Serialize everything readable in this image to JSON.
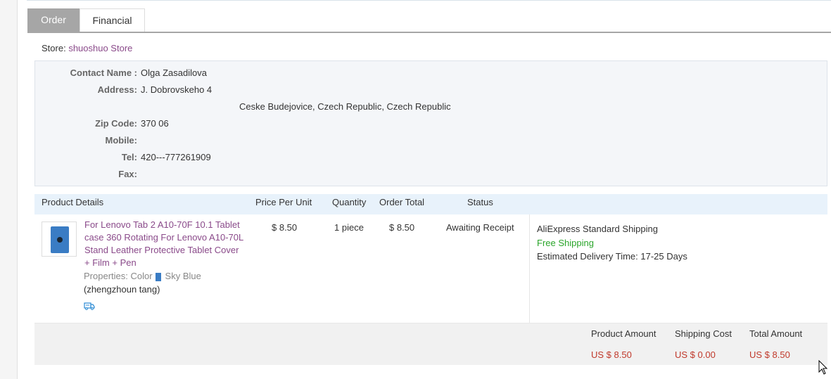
{
  "tabs": [
    "Order",
    "Financial"
  ],
  "store": {
    "label": "Store:",
    "name": "shuoshuo Store"
  },
  "address": {
    "contact_label": "Contact Name :",
    "contact": "Olga Zasadilova",
    "address_label": "Address:",
    "address_line1": "J. Dobrovskeho 4",
    "address_line2": "Ceske Budejovice, Czech Republic, Czech Republic",
    "zip_label": "Zip Code:",
    "zip": "370 06",
    "mobile_label": "Mobile:",
    "mobile": "",
    "tel_label": "Tel:",
    "tel": "420---777261909",
    "fax_label": "Fax:",
    "fax": ""
  },
  "table": {
    "headers": [
      "Product Details",
      "Price Per Unit",
      "Quantity",
      "Order Total",
      "Status"
    ]
  },
  "product": {
    "title": "For Lenovo Tab 2 A10-70F 10.1 Tablet case 360 Rotating For Lenovo A10-70L Stand Leather Protective Tablet Cover + Film + Pen",
    "properties_label": "Properties: Color",
    "color": "Sky Blue",
    "seller": "(zhengzhoun tang)",
    "price": "$ 8.50",
    "quantity": "1 piece",
    "order_total": "$ 8.50",
    "status": "Awaiting Receipt",
    "shipping_method": "AliExpress Standard Shipping",
    "shipping_free": "Free Shipping",
    "delivery_label": "Estimated Delivery Time:",
    "delivery_time": "17-25 Days"
  },
  "summary": {
    "product_amount_label": "Product Amount",
    "product_amount": "US $ 8.50",
    "shipping_cost_label": "Shipping Cost",
    "shipping_cost": "US $ 0.00",
    "total_amount_label": "Total Amount",
    "total_amount": "US $ 8.50"
  },
  "colors": {
    "link": "#8a4a8a",
    "price": "#c0392b",
    "free_shipping": "#2aa52a",
    "tab_active": "#a6a6a6"
  },
  "icons": [
    "truck-icon",
    "cursor-icon"
  ]
}
